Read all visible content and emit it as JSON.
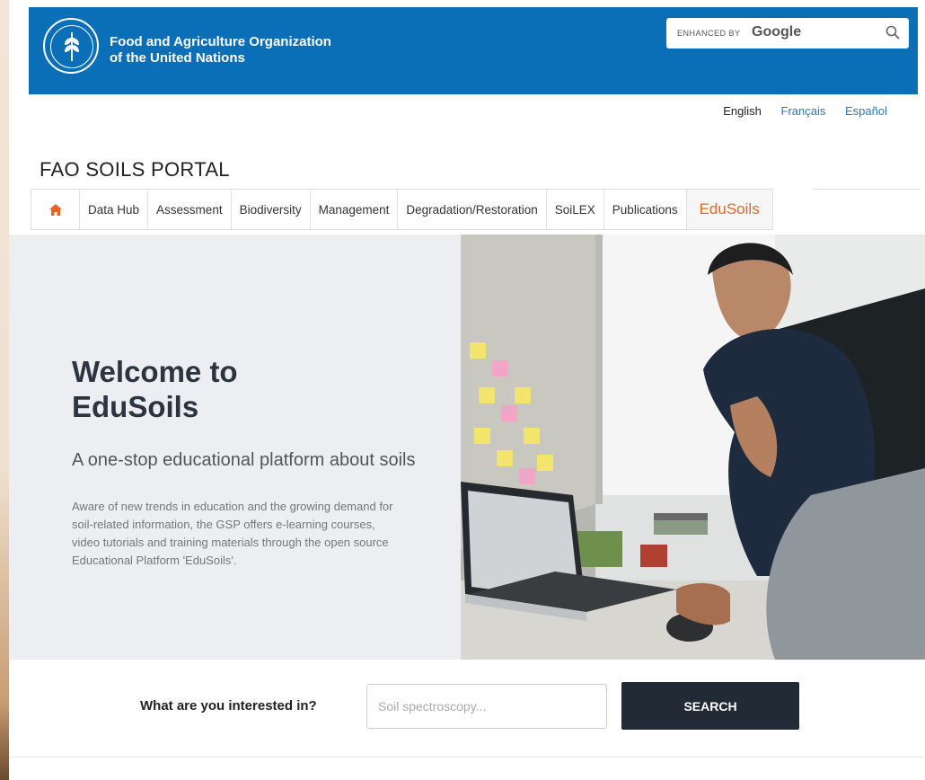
{
  "header": {
    "org_name_line1": "Food and Agriculture Organization",
    "org_name_line2": "of the United Nations",
    "search_enhanced": "ENHANCED BY",
    "search_google": "Google",
    "brand_color": "#0b6fb8"
  },
  "languages": [
    "English",
    "Français",
    "Español"
  ],
  "portal_title": "FAO SOILS PORTAL",
  "nav": {
    "home_icon": "home-icon",
    "items": [
      "Data Hub",
      "Assessment",
      "Biodiversity",
      "Management",
      "Degradation/Restoration",
      "SoiLEX",
      "Publications",
      "EduSoils"
    ],
    "active": "EduSoils",
    "active_color": "#e0662a"
  },
  "hero": {
    "title": "Welcome to EduSoils",
    "subtitle": "A one-stop educational platform about soils",
    "body": "Aware of new trends in education and the growing demand for soil-related information, the GSP offers e-learning courses, video tutorials and training materials through the open source Educational Platform 'EduSoils'."
  },
  "search": {
    "label": "What are you interested in?",
    "placeholder": "Soil spectroscopy...",
    "button": "SEARCH"
  }
}
